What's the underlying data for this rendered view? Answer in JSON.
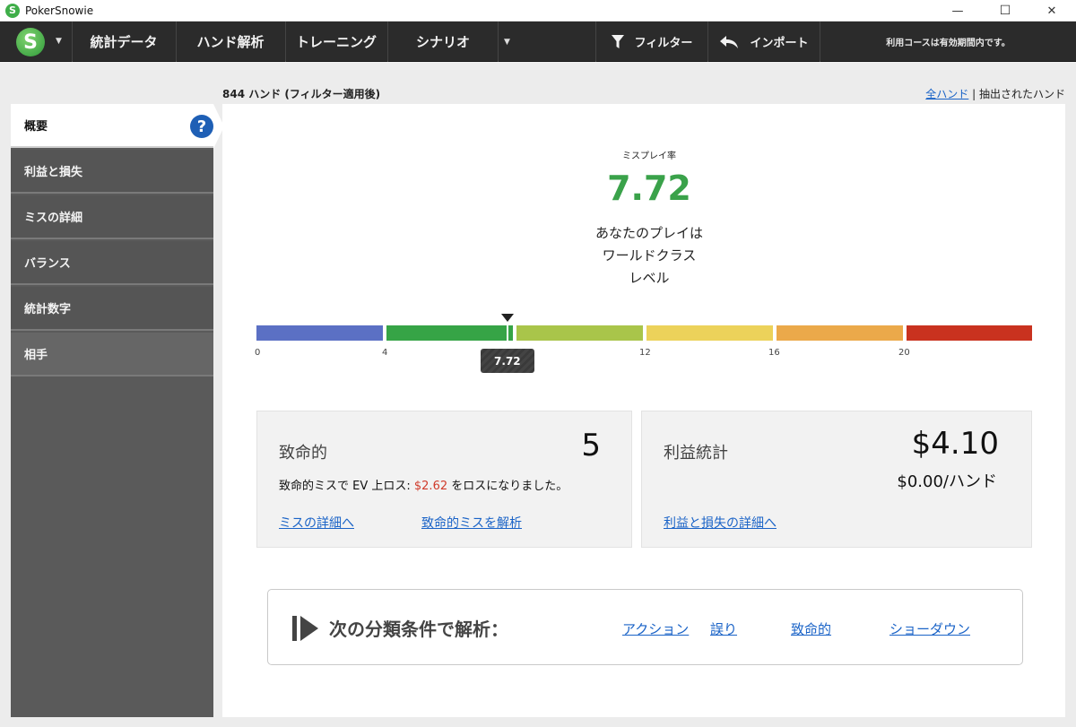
{
  "window": {
    "title": "PokerSnowie",
    "app_icon_letter": "S",
    "minimize_glyph": "—",
    "maximize_glyph": "☐",
    "close_glyph": "✕"
  },
  "toolbar": {
    "logo_letter": "S",
    "menu": [
      "統計データ",
      "ハンド解析",
      "トレーニング",
      "シナリオ"
    ],
    "filter_label": "フィルター",
    "import_label": "インポート",
    "notice": "利用コースは有効期間内です。"
  },
  "header": {
    "hands_count": "844 ハンド (フィルター適用後)",
    "all_hands_link": "全ハンド",
    "separator": " | ",
    "extracted_label": "抽出されたハンド"
  },
  "sidebar": {
    "items": [
      "概要",
      "利益と損失",
      "ミスの詳細",
      "バランス",
      "統計数字",
      "相手"
    ],
    "help_glyph": "?"
  },
  "summary": {
    "misplay_label": "ミスプレイ率",
    "misplay_value": "7.72",
    "level_lines": [
      "あなたのプレイは",
      "ワールドクラス",
      "レベル"
    ]
  },
  "scale": {
    "ticks": [
      "0",
      "4",
      "12",
      "16",
      "20"
    ],
    "marker_value": 7.72,
    "marker_label": "7.72",
    "colors": [
      "#5b70c4",
      "#36a446",
      "#a9c54a",
      "#ecd25a",
      "#eba94a",
      "#c9321f"
    ]
  },
  "blunder_card": {
    "title": "致命的",
    "count": "5",
    "desc_prefix": "致命的ミスで EV 上ロス: ",
    "loss_amount": "$2.62",
    "desc_suffix": " をロスになりました。",
    "link_details": "ミスの詳細へ",
    "link_analyze": "致命的ミスを解析"
  },
  "profit_card": {
    "title": "利益統計",
    "total": "$4.10",
    "per_hand": "$0.00/ハンド",
    "link_details": "利益と損失の詳細へ"
  },
  "analyze": {
    "label": "次の分類条件で解析：",
    "links": [
      "アクション",
      "誤り",
      "致命的",
      "ショーダウン"
    ]
  }
}
